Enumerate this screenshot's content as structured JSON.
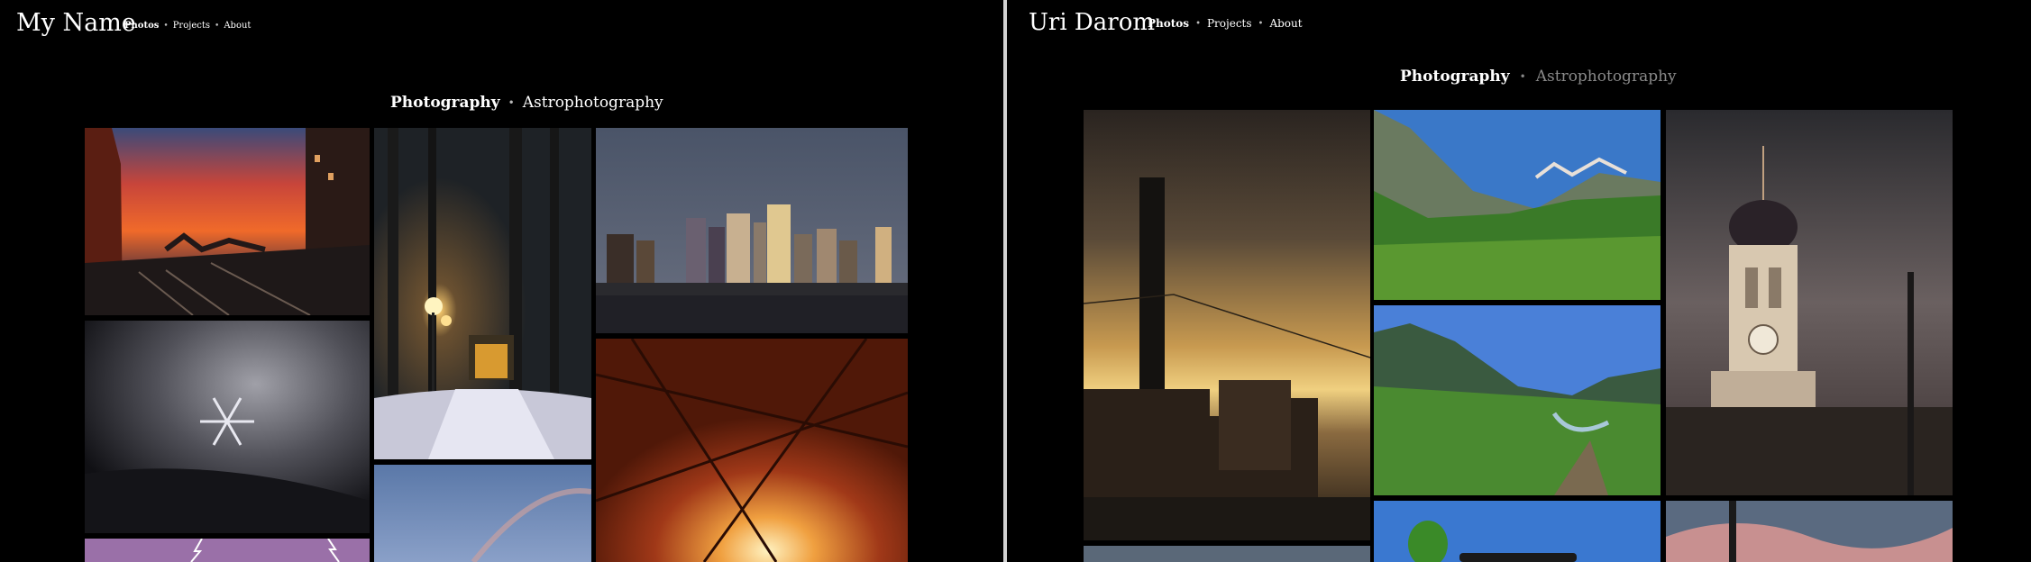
{
  "left": {
    "site_title": "My Name",
    "nav": {
      "photos": "Photos",
      "projects": "Projects",
      "about": "About"
    },
    "categories": {
      "photography": "Photography",
      "astrophotography": "Astrophotography"
    }
  },
  "right": {
    "site_title": "Uri Darom",
    "nav": {
      "photos": "Photos",
      "projects": "Projects",
      "about": "About"
    },
    "categories": {
      "photography": "Photography",
      "astrophotography": "Astrophotography"
    }
  },
  "colors": {
    "background": "#000000",
    "divider": "#d2d2d2",
    "inactive_category": "#8a8a8a"
  },
  "icons": {
    "separator": "bullet"
  }
}
